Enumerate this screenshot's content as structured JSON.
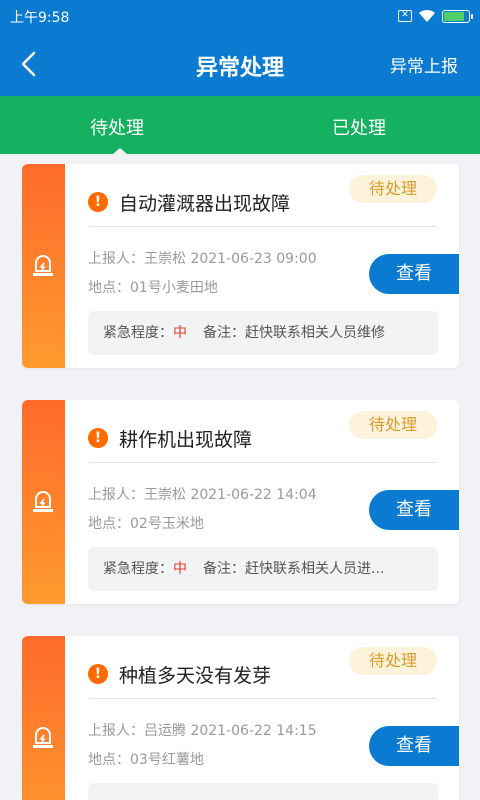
{
  "status_bar": {
    "time": "上午9:58",
    "icons": [
      "sim-x-icon",
      "wifi-icon",
      "battery-icon"
    ],
    "battery_level_pct": 90
  },
  "header": {
    "title": "异常处理",
    "right_action": "异常上报"
  },
  "tabs": [
    {
      "label": "待处理",
      "active": true
    },
    {
      "label": "已处理",
      "active": false
    }
  ],
  "colors": {
    "header": "#0a7bd1",
    "tabs": "#16b160",
    "stripe": "#ff6a2b",
    "status_bg": "#fdf3dc",
    "status_text": "#d99b2b",
    "urgency": "#e03b2b"
  },
  "cards": [
    {
      "title": "自动灌溉器出现故障",
      "status": "待处理",
      "reporter": "上报人：王崇松 2021-06-23 09:00",
      "location": "地点：01号小麦田地",
      "button": "查看",
      "urgency_label": "紧急程度：",
      "urgency_value": "中",
      "note": "备注：赶快联系相关人员维修"
    },
    {
      "title": "耕作机出现故障",
      "status": "待处理",
      "reporter": "上报人：王崇松 2021-06-22 14:04",
      "location": "地点：02号玉米地",
      "button": "查看",
      "urgency_label": "紧急程度：",
      "urgency_value": "中",
      "note": "备注：赶快联系相关人员进..."
    },
    {
      "title": "种植多天没有发芽",
      "status": "待处理",
      "reporter": "上报人：吕运腾 2021-06-22 14:15",
      "location": "地点：03号红薯地",
      "button": "查看",
      "urgency_label": "",
      "urgency_value": "",
      "note": ""
    }
  ]
}
